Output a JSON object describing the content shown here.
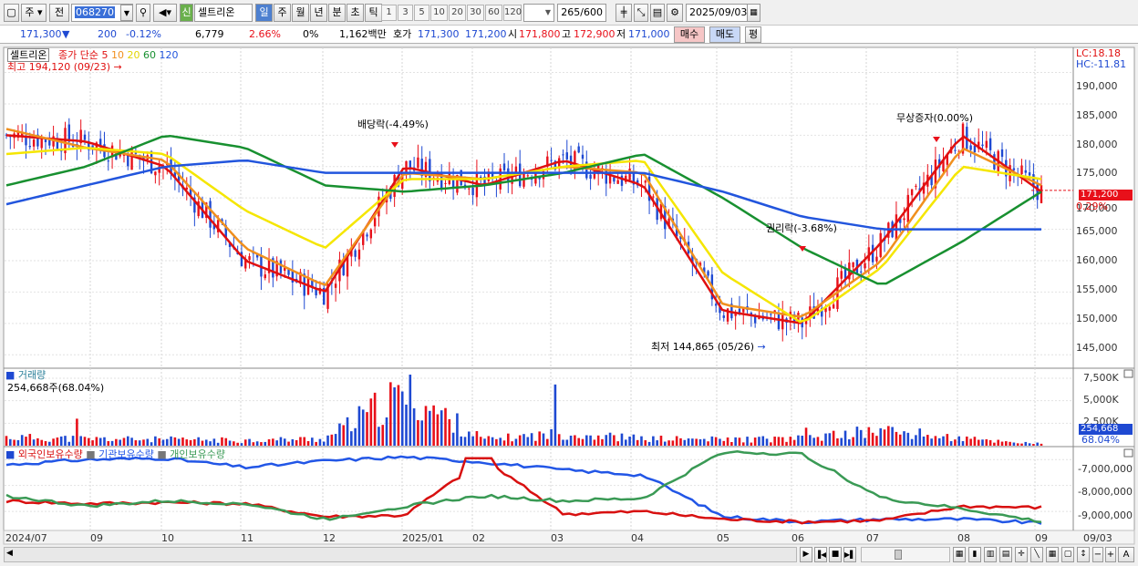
{
  "toolbar": {
    "period_tabs": {
      "week": "주",
      "prev": "전"
    },
    "stock_code": "068270",
    "new_badge": "신",
    "stock_name": "셀트리온",
    "timeframes": [
      "일",
      "주",
      "월",
      "년",
      "분",
      "초",
      "틱"
    ],
    "active_timeframe": "일",
    "periods": [
      "1",
      "3",
      "5",
      "10",
      "20",
      "30",
      "60",
      "120"
    ],
    "count_display": "265",
    "count_total": "/600",
    "date": "2025/09/03"
  },
  "quote": {
    "price": "171,300",
    "change_arrow": "▼",
    "change": "200",
    "change_pct": "-0.12%",
    "volume": "6,779",
    "volume_pct": "2.66%",
    "zero_pct": "0%",
    "amount": "1,162백만",
    "ask_label": "호가",
    "ask": "171,300",
    "bid": "171,200",
    "open_label": "시",
    "open": "171,800",
    "high_label": "고",
    "high": "172,900",
    "low_label": "저",
    "low": "171,000",
    "buy_btn": "매수",
    "sell_btn": "매도",
    "eval_btn": "평"
  },
  "legend": {
    "name": "셀트리온",
    "ma_label": "종가 단순",
    "ma5": "5",
    "ma10": "10",
    "ma20": "20",
    "ma60": "60",
    "ma120": "120",
    "high_note": "최고 194,120 (09/23)",
    "volume_title": "거래량",
    "volume_value": "254,668주(68.04%)",
    "holdings": [
      "외국인보유수량",
      "기관보유수량",
      "개인보유수량"
    ]
  },
  "annotations": {
    "dividend": "배당락(-4.49%)",
    "rights": "권리락(-3.68%)",
    "bonus": "무상증자(0.00%)",
    "low_note": "최저 144,865 (05/26)"
  },
  "right_axis": {
    "lc": "LC:18.18",
    "hc": "HC:-11.81",
    "price_ticks": [
      "190,000",
      "185,000",
      "180,000",
      "175,000",
      "170,000",
      "165,000",
      "160,000",
      "155,000",
      "150,000",
      "145,000"
    ],
    "current_price": "171,200",
    "current_pct": "0.29%",
    "volume_ticks": [
      "7,500K",
      "5,000K",
      "2,500K"
    ],
    "current_volume": "254,668",
    "current_volume_pct": "68.04%",
    "holding_ticks": [
      "-7,000,000",
      "-8,000,000",
      "-9,000,000"
    ]
  },
  "x_axis": [
    "2024/07",
    "09",
    "10",
    "11",
    "12",
    "2025/01",
    "02",
    "03",
    "04",
    "05",
    "06",
    "07",
    "08",
    "09",
    "09/03"
  ],
  "colors": {
    "up": "#e8101a",
    "down": "#1e49d2",
    "ma5": "#e01010",
    "ma10": "#f0901e",
    "ma20": "#f5e600",
    "ma60": "#189030",
    "ma120": "#2255dd",
    "foreign": "#2256e6",
    "institution": "#d81010",
    "individual": "#3a9a55"
  },
  "chart_data": [
    {
      "type": "line",
      "title": "셀트리온",
      "ylim": [
        143000,
        194000
      ],
      "x": [
        "2024/07",
        "09",
        "10",
        "11",
        "12",
        "2025/01",
        "02",
        "03",
        "04",
        "05",
        "06",
        "07",
        "08",
        "09"
      ],
      "series": [
        {
          "name": "5",
          "values": [
            180000,
            179000,
            175000,
            160000,
            155000,
            175000,
            172000,
            176000,
            172000,
            152000,
            150000,
            163000,
            180000,
            171000
          ]
        },
        {
          "name": "10",
          "values": [
            181000,
            178000,
            176000,
            162000,
            156000,
            174000,
            173000,
            175000,
            174000,
            153000,
            151000,
            160000,
            178000,
            172000
          ]
        },
        {
          "name": "20",
          "values": [
            177000,
            178000,
            177000,
            168000,
            162000,
            173000,
            173000,
            175000,
            176000,
            158000,
            150000,
            159000,
            175000,
            173000
          ]
        },
        {
          "name": "60",
          "values": [
            172000,
            175000,
            180000,
            178000,
            172000,
            171000,
            172000,
            174000,
            177000,
            170000,
            162000,
            156000,
            163000,
            171000
          ]
        },
        {
          "name": "120",
          "values": [
            169000,
            172000,
            175000,
            176000,
            174000,
            174000,
            174000,
            174000,
            174000,
            171000,
            167000,
            165000,
            165000,
            165000
          ]
        }
      ]
    },
    {
      "type": "bar",
      "title": "거래량",
      "ylim": [
        0,
        8000000
      ],
      "categories": [
        "2024/07",
        "09",
        "10",
        "11",
        "12",
        "2025/01",
        "02",
        "03",
        "04",
        "05",
        "06",
        "07",
        "08",
        "09"
      ],
      "values": [
        1100000,
        900000,
        800000,
        700000,
        900000,
        6800000,
        800000,
        1600000,
        900000,
        800000,
        900000,
        2000000,
        900000,
        254668
      ]
    },
    {
      "type": "line",
      "ylim": [
        -9700000,
        -6500000
      ],
      "x": [
        "2024/07",
        "09",
        "10",
        "11",
        "12",
        "2025/01",
        "02",
        "03",
        "04",
        "05",
        "06",
        "07",
        "08",
        "09"
      ],
      "series": [
        {
          "name": "외국인보유수량",
          "values": [
            -7200000,
            -7000000,
            -6950000,
            -7300000,
            -7050000,
            -6900000,
            -7100000,
            -7400000,
            -7600000,
            -9200000,
            -9400000,
            -9300000,
            -9300000,
            -9450000
          ]
        },
        {
          "name": "기관보유수량",
          "values": [
            -8600000,
            -8700000,
            -8650000,
            -8700000,
            -9200000,
            -9150000,
            -7000000,
            -9100000,
            -9000000,
            -9300000,
            -9400000,
            -9350000,
            -8800000,
            -8850000
          ]
        },
        {
          "name": "개인보유수량",
          "values": [
            -8400000,
            -8800000,
            -8600000,
            -8700000,
            -9300000,
            -8800000,
            -8400000,
            -8600000,
            -8500000,
            -6700000,
            -6800000,
            -8500000,
            -8900000,
            -9400000
          ]
        }
      ]
    }
  ]
}
